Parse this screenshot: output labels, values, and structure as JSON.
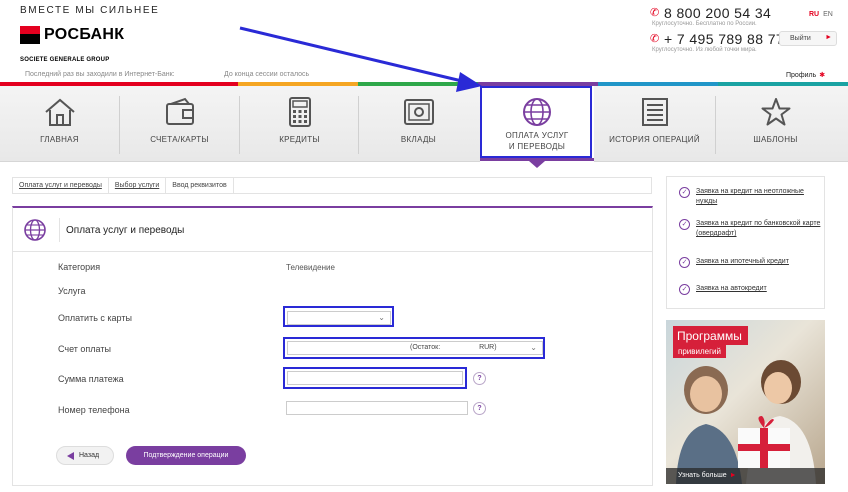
{
  "header": {
    "tagline": "ВМЕСТЕ МЫ СИЛЬНЕЕ",
    "logo_text": "РОСБАНК",
    "logo_sub": "SOCIETE GENERALE GROUP",
    "last_visit": "Последний раз вы заходили в Интернет-Банк:",
    "session": "До конца сессии осталось",
    "phone1": "8 800 200 54 34",
    "phone1_note": "Круглосуточно. Бесплатно по России.",
    "phone2": "+ 7 495 789 88 77",
    "phone2_note": "Круглосуточно. Из любой точки мира.",
    "lang_ru": "RU",
    "lang_en": "EN",
    "logout": "Выйти",
    "profile": "Профиль"
  },
  "colors": {
    "brand_red": "#e4001f",
    "accent_purple": "#7a3ea0",
    "annotation_blue": "#2a2ad6",
    "colorbar": [
      "#e4001f",
      "#f5a623",
      "#2ea84a",
      "#7a3ea0",
      "#2196c8",
      "#1aa3a3"
    ]
  },
  "nav": {
    "items": [
      {
        "label": "ГЛАВНАЯ",
        "icon": "home-icon"
      },
      {
        "label": "СЧЕТА/КАРТЫ",
        "icon": "wallet-icon"
      },
      {
        "label": "КРЕДИТЫ",
        "icon": "calculator-icon"
      },
      {
        "label": "ВКЛАДЫ",
        "icon": "safe-icon"
      },
      {
        "label_line1": "ОПЛАТА УСЛУГ",
        "label_line2": "И ПЕРЕВОДЫ",
        "icon": "globe-icon",
        "active": true
      },
      {
        "label": "ИСТОРИЯ ОПЕРАЦИЙ",
        "icon": "list-icon"
      },
      {
        "label": "ШАБЛОНЫ",
        "icon": "star-icon"
      }
    ]
  },
  "breadcrumbs": [
    "Оплата услуг и переводы",
    "Выбор услуги",
    "Ввод реквизитов"
  ],
  "form": {
    "title": "Оплата услуг и переводы",
    "category_label": "Категория",
    "category_value": "Телевидение",
    "service_label": "Услуга",
    "card_label": "Оплатить с карты",
    "card_value": "",
    "account_label": "Счет оплаты",
    "account_value": "(Остаток:                    RUR)",
    "amount_label": "Сумма платежа",
    "amount_value": "",
    "phone_label": "Номер телефона",
    "phone_value": "",
    "help_symbol": "?",
    "back_button": "Назад",
    "confirm_button": "Подтверждение операции"
  },
  "side_links": [
    "Заявка на кредит на неотложные нужды",
    "Заявка на кредит по банковской карте (овердрафт)",
    "Заявка на ипотечный кредит",
    "Заявка на автокредит"
  ],
  "promo": {
    "title": "Программы",
    "subtitle": "привилегий",
    "more": "Узнать больше"
  }
}
